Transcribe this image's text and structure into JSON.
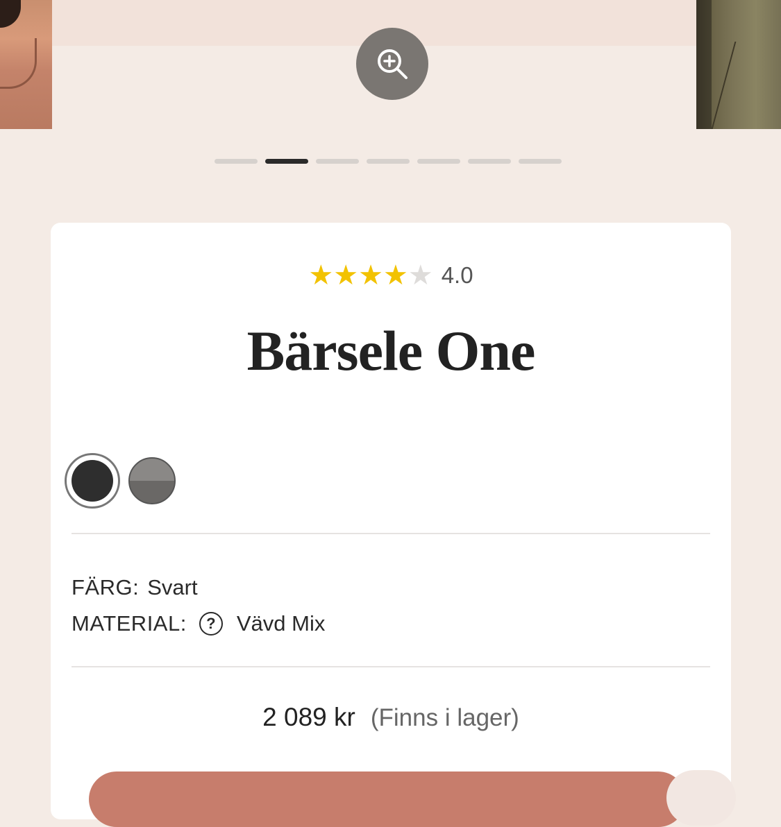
{
  "gallery": {
    "slide_count": 7,
    "active_slide": 2,
    "zoom_icon": "zoom-in-icon"
  },
  "product": {
    "rating_value": "4.0",
    "rating_stars": 4,
    "rating_max": 5,
    "title": "Bärsele One",
    "swatches": [
      {
        "name": "Svart",
        "color": "#2e2e2e",
        "selected": true
      },
      {
        "name": "grey",
        "color": "#8a8886",
        "selected": false
      }
    ],
    "color_label": "FÄRG:",
    "color_value": "Svart",
    "material_label": "MATERIAL:",
    "material_help_icon": "question-icon",
    "material_value": "Vävd Mix",
    "price": "2 089 kr",
    "stock_status": "(Finns i lager)"
  },
  "colors": {
    "background": "#f4ebe5",
    "card": "#ffffff",
    "star": "#f2c200",
    "cta": "#c77d6c"
  }
}
